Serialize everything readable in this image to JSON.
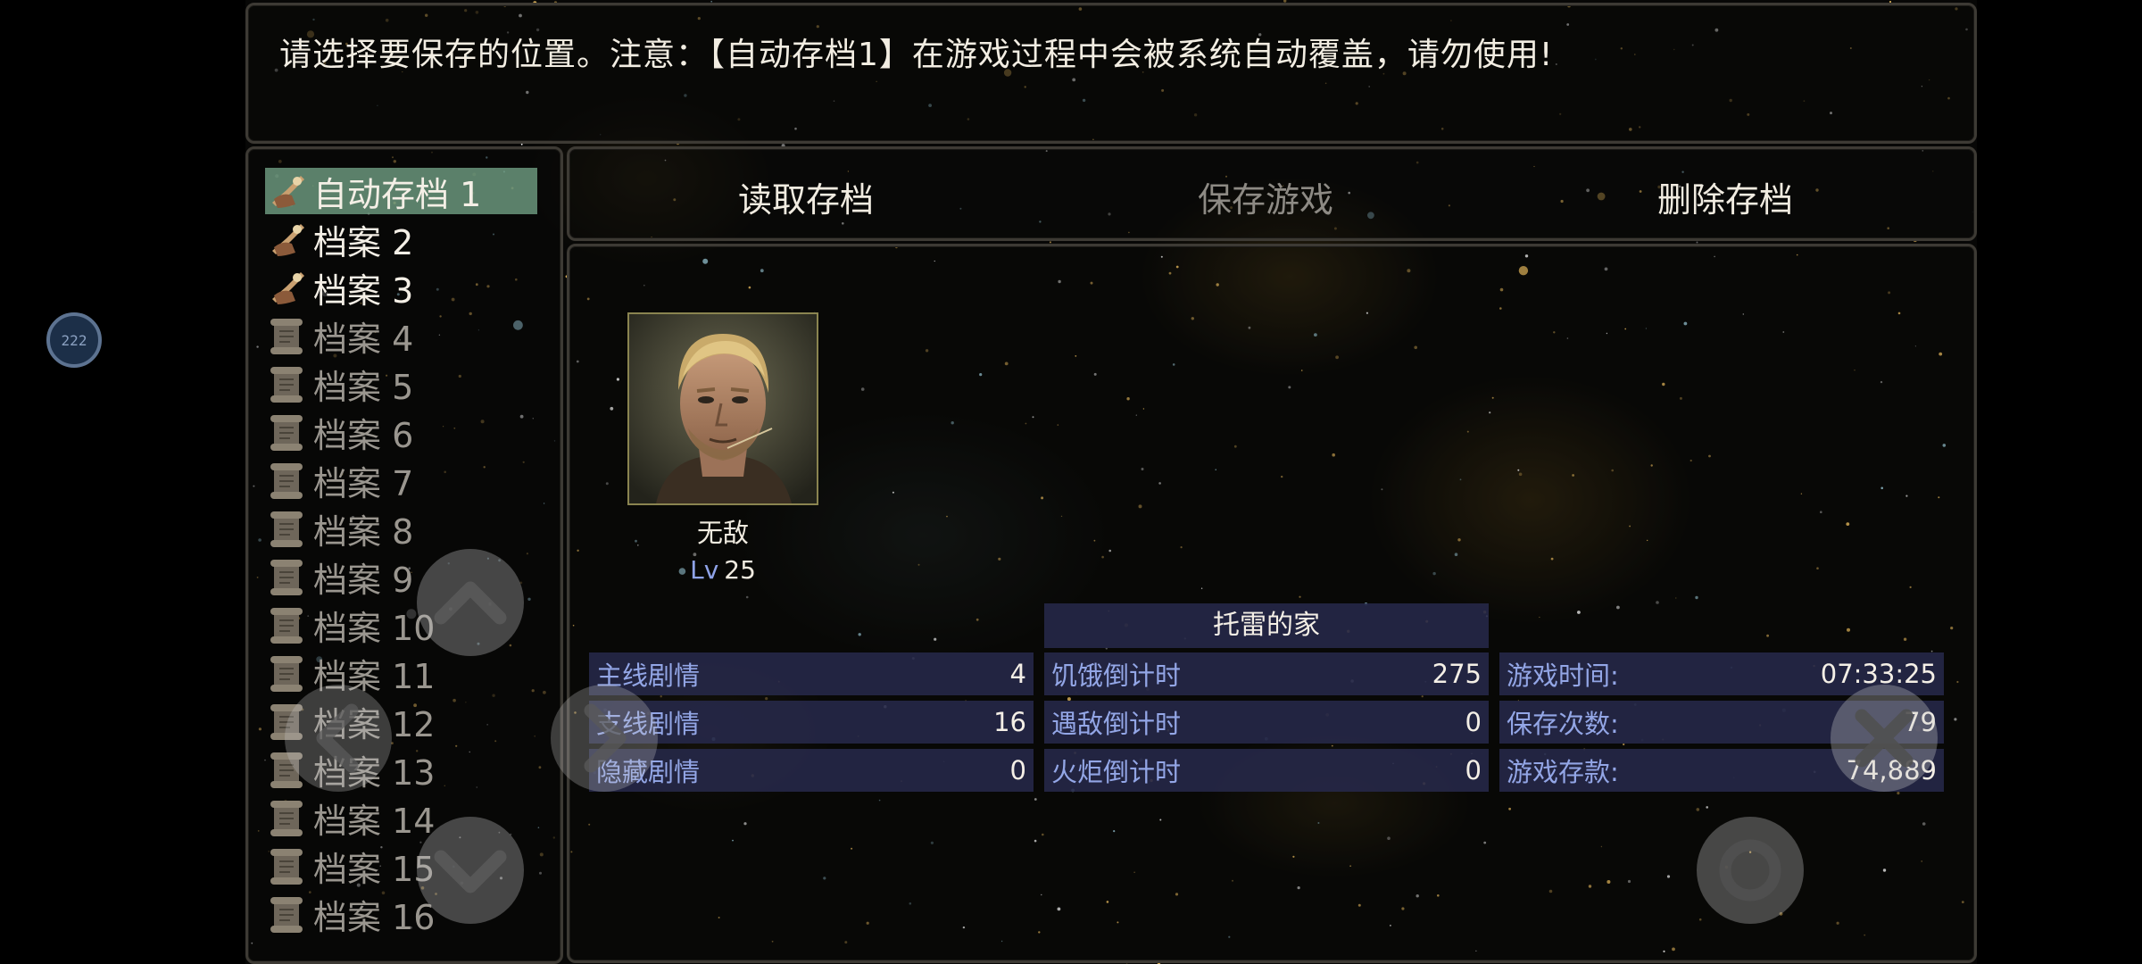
{
  "notice": "请选择要保存的位置。注意：【自动存档1】在游戏过程中会被系统自动覆盖，请勿使用!",
  "overlay_badge": "222",
  "tabs": {
    "load": "读取存档",
    "save": "保存游戏",
    "delete": "删除存档"
  },
  "slots": [
    {
      "label": "自动存档 1",
      "state": "used",
      "selected": true
    },
    {
      "label": "档案 2",
      "state": "used"
    },
    {
      "label": "档案 3",
      "state": "used"
    },
    {
      "label": "档案 4",
      "state": "empty"
    },
    {
      "label": "档案 5",
      "state": "empty"
    },
    {
      "label": "档案 6",
      "state": "empty"
    },
    {
      "label": "档案 7",
      "state": "empty"
    },
    {
      "label": "档案 8",
      "state": "empty"
    },
    {
      "label": "档案 9",
      "state": "empty"
    },
    {
      "label": "档案 10",
      "state": "empty"
    },
    {
      "label": "档案 11",
      "state": "empty"
    },
    {
      "label": "档案 12",
      "state": "empty"
    },
    {
      "label": "档案 13",
      "state": "empty"
    },
    {
      "label": "档案 14",
      "state": "empty"
    },
    {
      "label": "档案 15",
      "state": "empty"
    },
    {
      "label": "档案 16",
      "state": "empty"
    }
  ],
  "character": {
    "name": "无敌",
    "level_prefix": "Lv",
    "level": "25"
  },
  "location": "托雷的家",
  "stats": {
    "main_story": {
      "label": "主线剧情",
      "value": "4"
    },
    "side_story": {
      "label": "支线剧情",
      "value": "16"
    },
    "hidden_story": {
      "label": "隐藏剧情",
      "value": "0"
    },
    "hunger": {
      "label": "饥饿倒计时",
      "value": "275"
    },
    "encounter": {
      "label": "遇敌倒计时",
      "value": "0"
    },
    "torch": {
      "label": "火炬倒计时",
      "value": "0"
    },
    "play_time": {
      "label": "游戏时间:",
      "value": "07:33:25"
    },
    "save_count": {
      "label": "保存次数:",
      "value": "79"
    },
    "money": {
      "label": "游戏存款:",
      "value": "74,889"
    }
  },
  "colors": {
    "selected_slot": "#78aa8c",
    "stat_bg": "#262848",
    "stat_key": "#93a6e6",
    "disabled_tab": "#8d8a84"
  }
}
